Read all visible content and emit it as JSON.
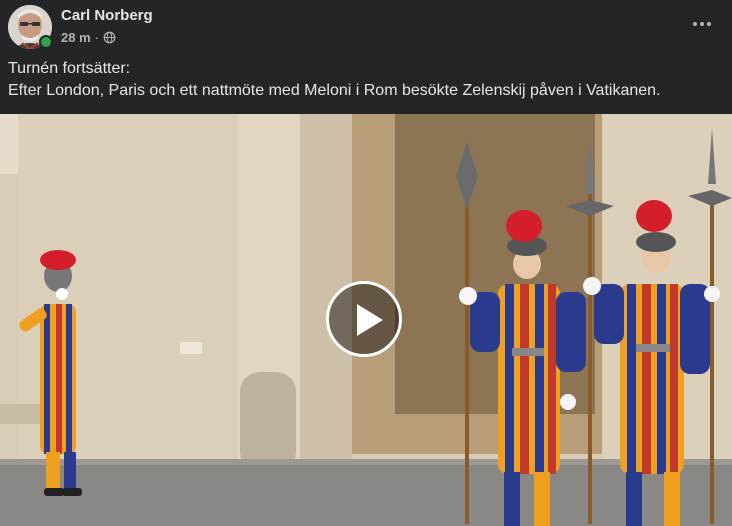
{
  "post": {
    "author": "Carl Norberg",
    "timestamp": "28 m",
    "separator": "·",
    "audience_icon": "globe-icon",
    "online_status": "online",
    "body_line1": "Turnén fortsätter:",
    "body_line2": "Efter London, Paris och ett nattmöte med Meloni i Rom besökte Zelenskij påven i Vatikanen.",
    "media": {
      "type": "video",
      "play_icon": "play-icon"
    }
  },
  "colors": {
    "background": "#242526",
    "primary_text": "#e4e6eb",
    "secondary_text": "#b0b3b8",
    "online": "#31a24c"
  }
}
